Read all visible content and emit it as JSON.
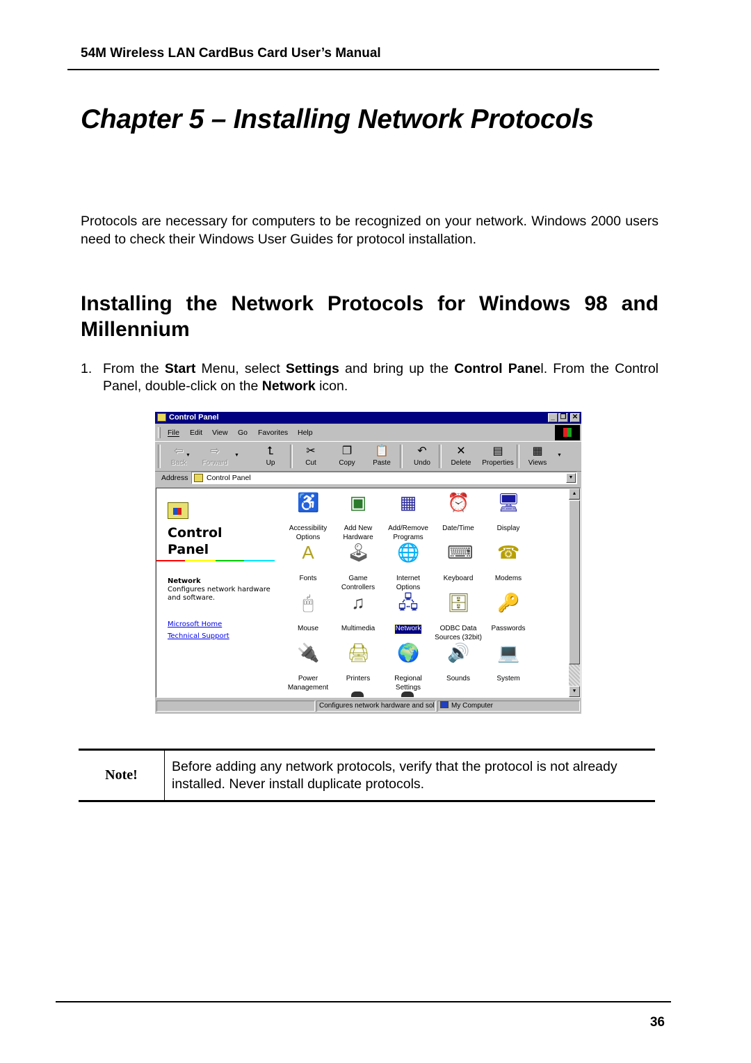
{
  "document": {
    "running_header": "54M Wireless LAN CardBus Card User’s Manual",
    "chapter_title": "Chapter 5 – Installing Network Protocols",
    "intro": "Protocols are necessary for computers to be recognized on your network. Windows 2000 users need to check their Windows User Guides for protocol installation.",
    "section_title": "Installing the Network Protocols for Windows 98 and Millennium",
    "step1": {
      "number": "1.",
      "parts": [
        "From the ",
        "Start",
        " Menu, select ",
        "Settings",
        " and bring up the ",
        "Control Pane",
        "l. From the Control Panel, double-click on the ",
        "Network",
        " icon."
      ]
    },
    "note": {
      "label": "Note!",
      "text": "Before adding any network protocols, verify that the protocol is not already installed. Never install duplicate protocols."
    },
    "page_number": "36"
  },
  "window": {
    "title": "Control Panel",
    "controls": {
      "minimize": "_",
      "maximize": "❐",
      "close": "✕"
    },
    "menu": [
      "File",
      "Edit",
      "View",
      "Go",
      "Favorites",
      "Help"
    ],
    "toolbar": [
      {
        "label": "Back",
        "icon": "back-arrow-icon",
        "glyph": "⇦",
        "enabled": false
      },
      {
        "label": "Forward",
        "icon": "forward-arrow-icon",
        "glyph": "⇨",
        "enabled": false
      },
      {
        "label": "Up",
        "icon": "up-folder-icon",
        "glyph": "⮤",
        "enabled": true
      },
      {
        "label": "Cut",
        "icon": "scissors-icon",
        "glyph": "✂",
        "enabled": true
      },
      {
        "label": "Copy",
        "icon": "copy-icon",
        "glyph": "❐",
        "enabled": true
      },
      {
        "label": "Paste",
        "icon": "paste-icon",
        "glyph": "📋",
        "enabled": true
      },
      {
        "label": "Undo",
        "icon": "undo-icon",
        "glyph": "↶",
        "enabled": true
      },
      {
        "label": "Delete",
        "icon": "delete-x-icon",
        "glyph": "✕",
        "enabled": true
      },
      {
        "label": "Properties",
        "icon": "properties-icon",
        "glyph": "▤",
        "enabled": true
      },
      {
        "label": "Views",
        "icon": "views-icon",
        "glyph": "▦",
        "enabled": true
      }
    ],
    "address": {
      "label": "Address",
      "value": "Control Panel"
    },
    "left_pane": {
      "title_line1": "Control",
      "title_line2": "Panel",
      "selected_name": "Network",
      "selected_description": "Configures network hardware and software.",
      "links": [
        "Microsoft Home",
        "Technical Support"
      ]
    },
    "items": [
      {
        "label": "Accessibility Options",
        "icon": "accessibility-icon",
        "glyph": "♿",
        "color": "#1f3fbf"
      },
      {
        "label": "Add New Hardware",
        "icon": "add-hardware-icon",
        "glyph": "▣",
        "color": "#2c7a2c"
      },
      {
        "label": "Add/Remove Programs",
        "icon": "add-remove-programs-icon",
        "glyph": "▦",
        "color": "#2a2a9a"
      },
      {
        "label": "Date/Time",
        "icon": "date-time-icon",
        "glyph": "⏰",
        "color": "#c02020"
      },
      {
        "label": "Display",
        "icon": "display-icon",
        "glyph": "🖥",
        "color": "#1a1aa0"
      },
      {
        "label": "Fonts",
        "icon": "fonts-icon",
        "glyph": "A",
        "color": "#b0a020"
      },
      {
        "label": "Game Controllers",
        "icon": "game-controllers-icon",
        "glyph": "🕹",
        "color": "#606060"
      },
      {
        "label": "Internet Options",
        "icon": "internet-options-icon",
        "glyph": "🌐",
        "color": "#1f6fbf"
      },
      {
        "label": "Keyboard",
        "icon": "keyboard-icon",
        "glyph": "⌨",
        "color": "#505050"
      },
      {
        "label": "Modems",
        "icon": "modems-icon",
        "glyph": "☎",
        "color": "#b8a000"
      },
      {
        "label": "Mouse",
        "icon": "mouse-icon",
        "glyph": "🖱",
        "color": "#707070"
      },
      {
        "label": "Multimedia",
        "icon": "multimedia-icon",
        "glyph": "♫",
        "color": "#404040"
      },
      {
        "label": "Network",
        "icon": "network-icon",
        "glyph": "🖧",
        "color": "#2030a0",
        "selected": true
      },
      {
        "label": "ODBC Data Sources (32bit)",
        "icon": "odbc-icon",
        "glyph": "🗄",
        "color": "#707020"
      },
      {
        "label": "Passwords",
        "icon": "passwords-keys-icon",
        "glyph": "🔑",
        "color": "#b09000"
      },
      {
        "label": "Power Management",
        "icon": "power-management-icon",
        "glyph": "🔌",
        "color": "#606060"
      },
      {
        "label": "Printers",
        "icon": "printers-icon",
        "glyph": "🖨",
        "color": "#a0a020"
      },
      {
        "label": "Regional Settings",
        "icon": "regional-settings-globe-icon",
        "glyph": "🌍",
        "color": "#208020"
      },
      {
        "label": "Sounds",
        "icon": "sounds-icon",
        "glyph": "🔊",
        "color": "#1a1aa0"
      },
      {
        "label": "System",
        "icon": "system-computer-icon",
        "glyph": "💻",
        "color": "#1a1aa0"
      }
    ],
    "status": {
      "description": "Configures network hardware and sol",
      "zone": "My Computer"
    }
  }
}
